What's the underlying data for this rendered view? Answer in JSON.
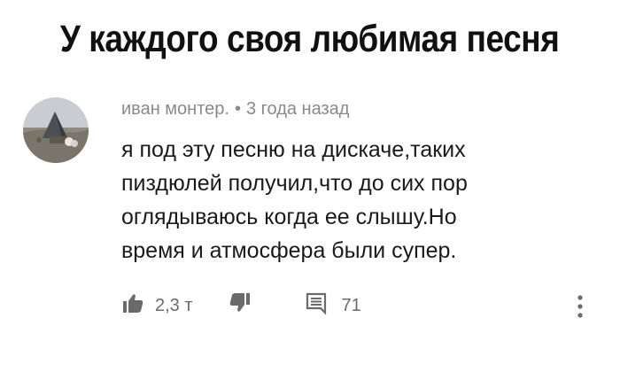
{
  "headline": "У каждого своя любимая песня",
  "comment": {
    "author": "иван монтер.",
    "separator": "•",
    "time": "3 года назад",
    "lines": [
      "я под эту песню на дискаче,таких",
      "пиздюлей получил,что до сих пор",
      "оглядываюсь когда ее слышу.Но",
      "время и атмосфера были супер."
    ]
  },
  "actions": {
    "likes": "2,3 т",
    "replies": "71"
  },
  "icons": {
    "like": "thumb-up-icon",
    "dislike": "thumb-down-icon",
    "reply": "comment-icon",
    "more": "more-vertical-icon"
  }
}
